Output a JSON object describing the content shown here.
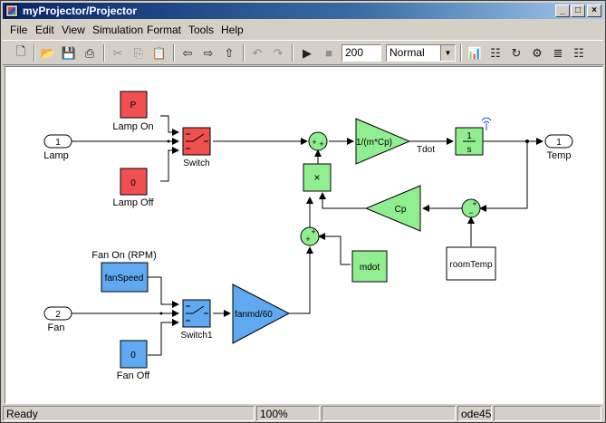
{
  "window": {
    "title": "myProjector/Projector",
    "min": "_",
    "max": "□",
    "close": "×"
  },
  "menu": [
    "File",
    "Edit",
    "View",
    "Simulation",
    "Format",
    "Tools",
    "Help"
  ],
  "toolbar": {
    "stop_time": "200",
    "sim_mode": "Normal"
  },
  "model": {
    "in_lamp": {
      "num": "1",
      "label": "Lamp"
    },
    "in_fan": {
      "num": "2",
      "label": "Fan"
    },
    "out_temp": {
      "num": "1",
      "label": "Temp"
    },
    "lamp_on": {
      "value": "P",
      "label": "Lamp On"
    },
    "lamp_off": {
      "value": "0",
      "label": "Lamp Off"
    },
    "switch": "Switch",
    "switch1": "Switch1",
    "fan_on": {
      "value": "fanSpeed",
      "label": "Fan On (RPM)"
    },
    "fan_off": {
      "value": "0",
      "label": "Fan Off"
    },
    "gain_mcp": "1/(m*Cp)",
    "tdot": "Tdot",
    "integrator": {
      "num": "1",
      "den": "s"
    },
    "product": "×",
    "gain_cp": "Cp",
    "gain_fan": "fanmd/60",
    "mdot": "mdot",
    "room_temp": "roomTemp",
    "sum_signs": {
      "plus": "+",
      "minus": "−"
    }
  },
  "status": {
    "state": "Ready",
    "zoom": "100%",
    "solver": "ode45"
  },
  "colors": {
    "red_block": "#f05050",
    "green_block": "#90ee90",
    "blue_block": "#60a8f0"
  }
}
